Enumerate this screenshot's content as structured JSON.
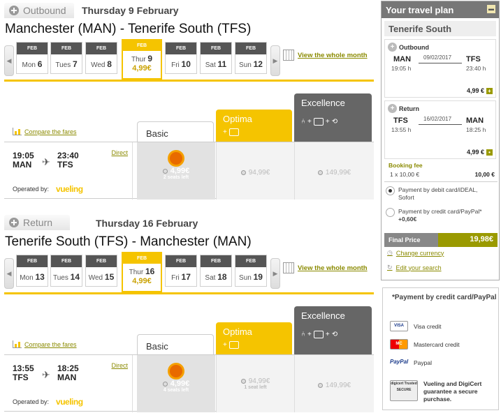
{
  "outbound": {
    "label": "Outbound",
    "day_title": "Thursday 9 February",
    "route": "Manchester (MAN) - Tenerife South (TFS)",
    "dates": [
      {
        "month": "FEB",
        "dow": "Mon",
        "day": "6"
      },
      {
        "month": "FEB",
        "dow": "Tues",
        "day": "7"
      },
      {
        "month": "FEB",
        "dow": "Wed",
        "day": "8"
      },
      {
        "month": "FEB",
        "dow": "Thur",
        "day": "9",
        "price": "4,99€",
        "selected": true
      },
      {
        "month": "FEB",
        "dow": "Fri",
        "day": "10"
      },
      {
        "month": "FEB",
        "dow": "Sat",
        "day": "11"
      },
      {
        "month": "FEB",
        "dow": "Sun",
        "day": "12"
      }
    ],
    "view_whole_month": "View the whole month",
    "compare": "Compare the fares",
    "fares": {
      "basic": "Basic",
      "optima": "Optima",
      "excellence": "Excellence"
    },
    "flight": {
      "dep_time": "19:05",
      "dep_apt": "MAN",
      "arr_time": "23:40",
      "arr_apt": "TFS",
      "direct": "Direct",
      "operated_by": "Operated by:",
      "carrier": "vueling",
      "basic_price": "4,99€",
      "basic_seats": "2 seats left",
      "optima_price": "94,99€",
      "optima_seats": "",
      "excellence_price": "149,99€"
    }
  },
  "return": {
    "label": "Return",
    "day_title": "Thursday 16 February",
    "route": "Tenerife South (TFS) - Manchester (MAN)",
    "dates": [
      {
        "month": "FEB",
        "dow": "Mon",
        "day": "13"
      },
      {
        "month": "FEB",
        "dow": "Tues",
        "day": "14"
      },
      {
        "month": "FEB",
        "dow": "Wed",
        "day": "15"
      },
      {
        "month": "FEB",
        "dow": "Thur",
        "day": "16",
        "price": "4,99€",
        "selected": true
      },
      {
        "month": "FEB",
        "dow": "Fri",
        "day": "17"
      },
      {
        "month": "FEB",
        "dow": "Sat",
        "day": "18"
      },
      {
        "month": "FEB",
        "dow": "Sun",
        "day": "19"
      }
    ],
    "view_whole_month": "View the whole month",
    "compare": "Compare the fares",
    "fares": {
      "basic": "Basic",
      "optima": "Optima",
      "excellence": "Excellence"
    },
    "flight": {
      "dep_time": "13:55",
      "dep_apt": "TFS",
      "arr_time": "18:25",
      "arr_apt": "MAN",
      "direct": "Direct",
      "operated_by": "Operated by:",
      "carrier": "vueling",
      "basic_price": "4,99€",
      "basic_seats": "4 seats left",
      "optima_price": "94,99€",
      "optima_seats": "1 seat left",
      "excellence_price": "149,99€"
    }
  },
  "plan": {
    "title": "Your travel plan",
    "destination": "Tenerife South",
    "outbound": {
      "label": "Outbound",
      "from": "MAN",
      "to": "TFS",
      "date": "09/02/2017",
      "dep": "19:05 h",
      "arr": "23:40 h",
      "price": "4,99 €"
    },
    "return": {
      "label": "Return",
      "from": "TFS",
      "to": "MAN",
      "date": "16/02/2017",
      "dep": "13:55 h",
      "arr": "18:25 h",
      "price": "4,99 €"
    },
    "booking_fee": "Booking fee",
    "fee_line": "1 x 10,00 €",
    "fee_amount": "10,00 €",
    "pay1": "Payment by debit card/iDEAL, Sofort",
    "pay2": "Payment by credit card/PayPal*",
    "pay2_extra": "+0,60€",
    "final_label": "Final Price",
    "final_price": "19,98€",
    "change_currency": "Change currency",
    "edit_search": "Edit your search"
  },
  "cards": {
    "title": "*Payment by credit card/PayPal",
    "visa": "Visa credit",
    "visa_logo": "VISA",
    "mastercard": "Mastercard credit",
    "mastercard_logo": "MC",
    "paypal": "Paypal",
    "paypal_logo": "PayPal",
    "digicert": "Vueling and DigiCert guarantee a secure purchase.",
    "digicert_logo": "digicert Trusted SECURE"
  },
  "colors": {
    "accent": "#f5c400",
    "dark": "#666666",
    "link": "#8a8a00"
  }
}
